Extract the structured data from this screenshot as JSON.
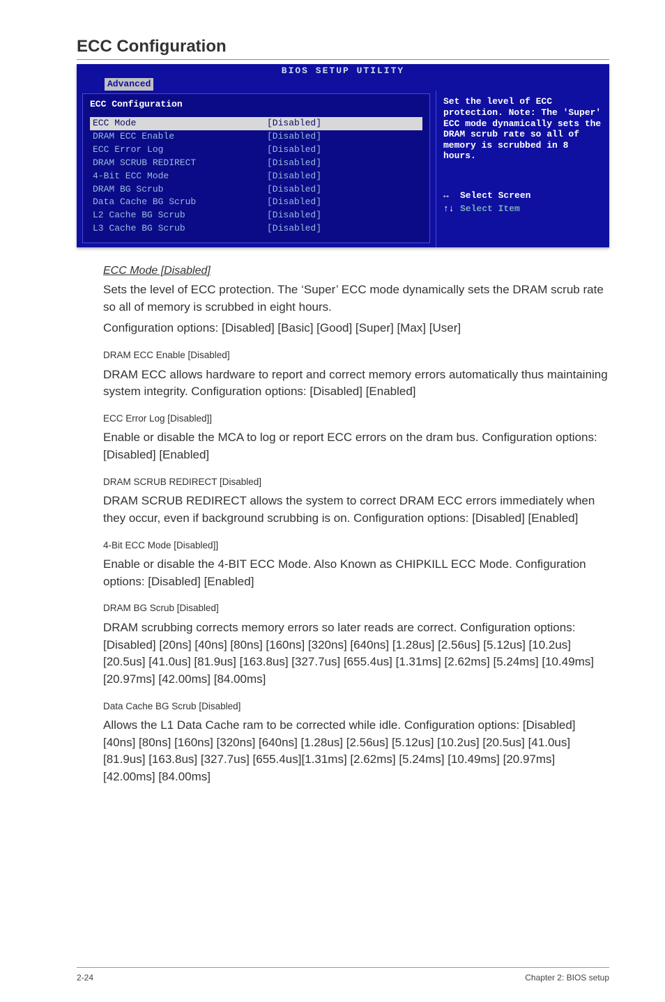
{
  "section_title": "ECC Configuration",
  "bios": {
    "header": "BIOS SETUP UTILITY",
    "tab": "Advanced",
    "panel_title": "ECC Configuration",
    "items": [
      {
        "label": "ECC Mode",
        "value": "[Disabled]",
        "selected": true
      },
      {
        "label": " DRAM ECC Enable",
        "value": "[Disabled]",
        "selected": false
      },
      {
        "label": " ECC Error Log",
        "value": "[Disabled]",
        "selected": false
      },
      {
        "label": " DRAM SCRUB REDIRECT",
        "value": "[Disabled]",
        "selected": false
      },
      {
        "label": " 4-Bit ECC Mode",
        "value": "[Disabled]",
        "selected": false
      },
      {
        "label": " DRAM BG Scrub",
        "value": "[Disabled]",
        "selected": false
      },
      {
        "label": " Data Cache BG Scrub",
        "value": "[Disabled]",
        "selected": false
      },
      {
        "label": " L2 Cache BG Scrub",
        "value": "[Disabled]",
        "selected": false
      },
      {
        "label": " L3 Cache BG Scrub",
        "value": "[Disabled]",
        "selected": false
      }
    ],
    "hint": "Set the level of ECC protection. Note: The 'Super' ECC mode dynamically sets the DRAM scrub rate so all of memory is scrubbed in 8 hours.",
    "legend1_label": "Select Screen",
    "legend2_label": "Select Item"
  },
  "main_item": {
    "title": "ECC Mode [Disabled]",
    "p1": "Sets the level of ECC protection. The ‘Super’ ECC mode dynamically sets the DRAM scrub rate so all of memory is scrubbed in eight hours.",
    "p2": "Configuration options: [Disabled] [Basic] [Good] [Super] [Max] [User]"
  },
  "subitems": [
    {
      "title": "DRAM ECC Enable [Disabled]",
      "desc": "DRAM ECC allows hardware to report and correct memory errors automatically thus maintaining system integrity. Configuration options: [Disabled] [Enabled]"
    },
    {
      "title": "ECC Error Log [Disabled]]",
      "desc": "Enable or disable the MCA to log or report ECC errors on the dram bus. Configuration options: [Disabled] [Enabled]"
    },
    {
      "title": "DRAM SCRUB REDIRECT [Disabled]",
      "desc": "DRAM SCRUB REDIRECT allows the system to correct DRAM ECC errors immediately when they occur, even if background scrubbing is on. Configuration options: [Disabled] [Enabled]"
    },
    {
      "title": "4-Bit ECC Mode [Disabled]]",
      "desc": "Enable or disable the 4-BIT ECC Mode. Also Known as CHIPKILL ECC Mode. Configuration options: [Disabled] [Enabled]"
    },
    {
      "title": "DRAM BG Scrub [Disabled]",
      "desc": "DRAM scrubbing corrects memory errors so later reads are correct. Configuration options: [Disabled] [20ns] [40ns] [80ns] [160ns] [320ns] [640ns] [1.28us] [2.56us] [5.12us] [10.2us] [20.5us] [41.0us] [81.9us] [163.8us] [327.7us] [655.4us] [1.31ms] [2.62ms] [5.24ms] [10.49ms] [20.97ms] [42.00ms] [84.00ms]"
    },
    {
      "title": "Data Cache BG Scrub [Disabled]",
      "desc": "Allows the L1 Data Cache ram to be corrected while idle. Configuration options: [Disabled] [40ns] [80ns] [160ns] [320ns] [640ns] [1.28us] [2.56us] [5.12us] [10.2us] [20.5us] [41.0us] [81.9us] [163.8us] [327.7us] [655.4us][1.31ms] [2.62ms] [5.24ms] [10.49ms] [20.97ms] [42.00ms] [84.00ms]"
    }
  ],
  "footer": {
    "left": "2-24",
    "right": "Chapter 2: BIOS setup"
  }
}
